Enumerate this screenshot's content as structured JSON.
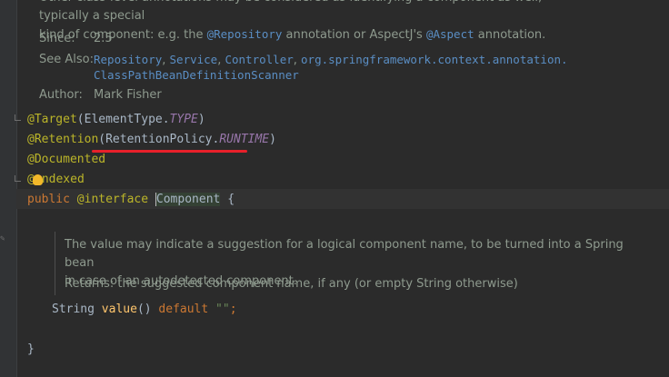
{
  "javadoc": {
    "intro_line1": "Other class-level annotations may be considered as identifying a component as well, typically a special",
    "intro_line2_a": "kind of component: e.g. the ",
    "intro_code1": "@Repository",
    "intro_line2_b": " annotation or AspectJ's ",
    "intro_code2": "@Aspect",
    "intro_line2_c": " annotation.",
    "since_label": "Since:",
    "since_value": "2.5",
    "see_also_label": "See Also:",
    "see_also_links": [
      "Repository",
      "Service",
      "Controller",
      "org.springframework.context.annotation.",
      "ClassPathBeanDefinitionScanner"
    ],
    "author_label": "Author:",
    "author_value": "Mark Fisher"
  },
  "code": {
    "target_ann": "@Target",
    "target_arg_class": "(ElementType.",
    "target_arg_const": "TYPE",
    "close_paren": ")",
    "retention_ann": "@Retention",
    "retention_arg_class": "(RetentionPolicy.",
    "retention_arg_const": "RUNTIME",
    "documented_ann": "@Documented",
    "indexed_ann_a": "@",
    "indexed_ann_b": "ndexed",
    "decl_public": "public",
    "decl_interface": "@interface",
    "decl_name": "Component",
    "decl_brace": "{",
    "method_type": "String",
    "method_name": "value",
    "method_parens": "()",
    "method_default": "default",
    "method_str": "\"\"",
    "method_semi": ";",
    "closing_brace": "}"
  },
  "method_doc": {
    "line1": "The value may indicate a suggestion for a logical component name, to be turned into a Spring bean",
    "line2": "in case of an autodetected component.",
    "returns": "Returns: the suggested component name, if any (or empty String otherwise)"
  },
  "gutter": {
    "mark": "✎"
  },
  "colors": {
    "annotation": "#bbb529",
    "keyword": "#cc7832",
    "constant": "#9876aa",
    "string": "#6a8759",
    "method": "#ffc66d",
    "underline": "#e8202a"
  }
}
